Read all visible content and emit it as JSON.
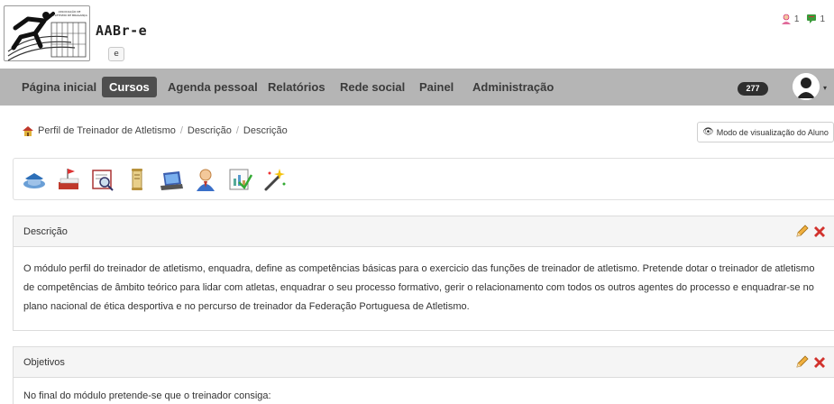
{
  "header": {
    "logo_text": "ASSOCIAÇÃO DE ATLETISMO DE BRAGANÇA",
    "site_name": "AABr-e",
    "site_badge": "e",
    "messages_count": "1",
    "notifications_count": "1"
  },
  "nav": {
    "items": [
      {
        "label": "Página inicial"
      },
      {
        "label": "Cursos"
      },
      {
        "label": "Agenda pessoal"
      },
      {
        "label": "Relatórios"
      },
      {
        "label": "Rede social"
      },
      {
        "label": "Painel"
      },
      {
        "label": "Administração"
      }
    ],
    "badge": "277",
    "active": "Cursos"
  },
  "breadcrumb": {
    "items": [
      "Perfil de Treinador de Atletismo",
      "Descrição",
      "Descrição"
    ],
    "separator": "/"
  },
  "student_view_button": "Modo de visualização do Aluno",
  "toolbar_icons": [
    "hat-icon",
    "book-flag-icon",
    "search-doc-icon",
    "scroll-icon",
    "laptop-icon",
    "user-icon",
    "chart-doc-icon",
    "magic-wand-icon"
  ],
  "panels": [
    {
      "title": "Descrição",
      "body": "O módulo perfil do treinador de atletismo, enquadra, define as competências básicas para o exercicio das funções de treinador de atletismo. Pretende dotar o treinador de atletismo de competências de âmbito teórico para lidar com atletas, enquadrar o seu processo formativo, gerir o relacionamento com todos os outros agentes do processo e enquadrar-se no plano nacional de ética desportiva e no percurso de treinador da Federação Portuguesa de Atletismo."
    },
    {
      "title": "Objetivos",
      "body": "No final do módulo pretende-se que o treinador consiga:"
    }
  ],
  "colors": {
    "navbar_bg": "#b5b5b5",
    "active_tab_bg": "#4e4e4e",
    "delete_red": "#d2322d",
    "edit_pencil": "#e8a33a"
  }
}
